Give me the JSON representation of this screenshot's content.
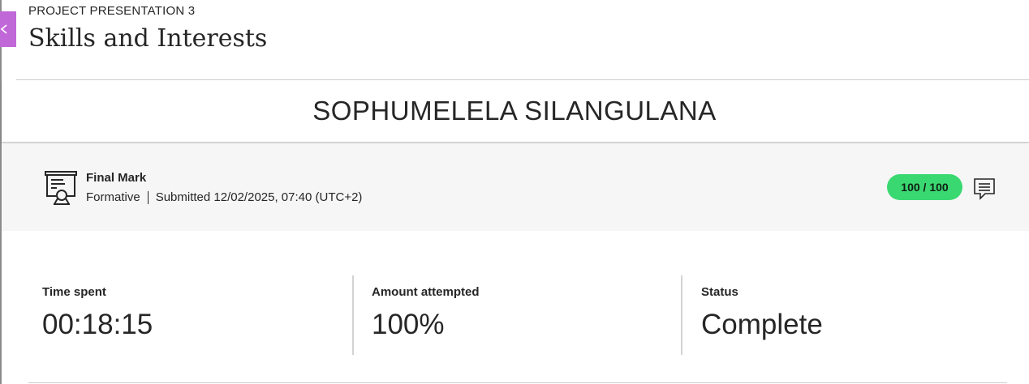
{
  "header": {
    "kicker": "PROJECT PRESENTATION 3",
    "title": "Skills and Interests",
    "close_icon": "close-x-icon"
  },
  "student": {
    "name": "SOPHUMELELA SILANGULANA"
  },
  "grade": {
    "icon": "certificate-presentation-icon",
    "title": "Final Mark",
    "type": "Formative",
    "submitted": "Submitted 12/02/2025, 07:40 (UTC+2)",
    "score": "100 / 100",
    "comment_icon": "feedback-comment-icon"
  },
  "stats": [
    {
      "label": "Time spent",
      "value": "00:18:15"
    },
    {
      "label": "Amount attempted",
      "value": "100%"
    },
    {
      "label": "Status",
      "value": "Complete"
    }
  ],
  "colors": {
    "accent_close": "#c168d8",
    "score_pill": "#3ad871",
    "band_bg": "#f6f6f6"
  }
}
